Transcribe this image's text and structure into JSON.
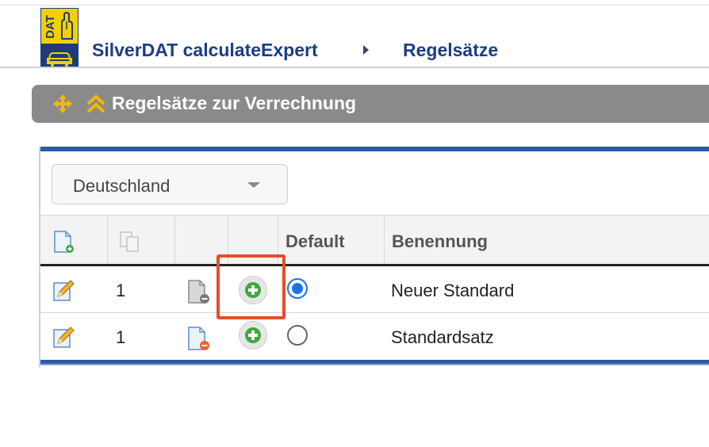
{
  "header": {
    "logo_text": "DAT",
    "app_title": "SilverDAT calculateExpert",
    "page_title": "Regelsätze"
  },
  "section": {
    "title": "Regelsätze zur Verrechnung",
    "icons": [
      "move-icon",
      "collapse-icon"
    ]
  },
  "filter": {
    "country_selected": "Deutschland"
  },
  "table": {
    "columns": [
      "",
      "",
      "",
      "",
      "Default",
      "Benennung"
    ],
    "column_icons": [
      "new-document-icon",
      "copy-icon"
    ],
    "rows": [
      {
        "count": "1",
        "default_checked": true,
        "name": "Neuer Standard",
        "icons": [
          "edit-icon",
          "document-remove-icon",
          "add-icon"
        ]
      },
      {
        "count": "1",
        "default_checked": false,
        "name": "Standardsatz",
        "icons": [
          "edit-icon",
          "document-remove-icon",
          "add-icon"
        ]
      }
    ]
  },
  "colors": {
    "brand_blue": "#1a3e85",
    "logo_yellow": "#f5d000",
    "section_bar": "#8a8a8a",
    "highlight": "#e74c2b",
    "radio_checked": "#1a73e8"
  }
}
